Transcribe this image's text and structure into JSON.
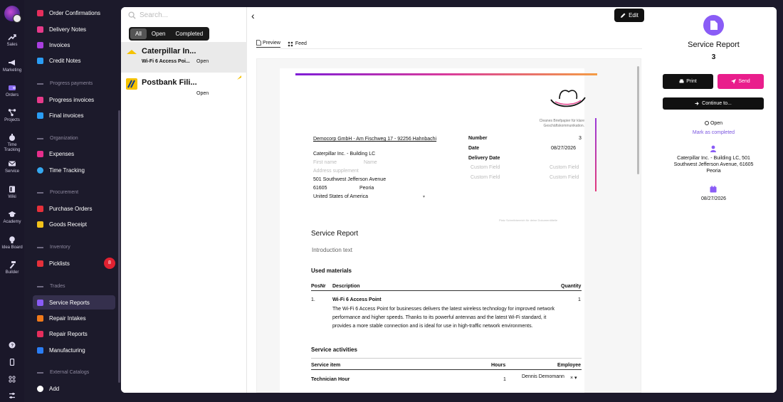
{
  "rail": {
    "items": [
      "Sales",
      "Marketing",
      "Orders",
      "Projects",
      "Time Tracking",
      "Service",
      "Wiki",
      "Academy",
      "Idea Board",
      "Builder"
    ]
  },
  "sidebar": {
    "items": [
      "Order Confirmations",
      "Delivery Notes",
      "Invoices",
      "Credit Notes",
      "Progress invoices",
      "Final invoices",
      "Expenses",
      "Time Tracking",
      "Purchase Orders",
      "Goods Receipt",
      "Picklists",
      "Service Reports",
      "Repair Intakes",
      "Repair Reports",
      "Manufacturing",
      "Add"
    ],
    "groups": [
      "Progress payments",
      "Organization",
      "Procurement",
      "Inventory",
      "Trades",
      "External Catalogs"
    ],
    "picklists_badge": "8"
  },
  "list": {
    "search_placeholder": "Search...",
    "filters": [
      "All",
      "Open",
      "Completed"
    ],
    "cards": [
      {
        "title": "Caterpillar In...",
        "sub": "Wi-Fi 6 Access Poi...",
        "status": "Open"
      },
      {
        "title": "Postbank Fili...",
        "sub": "",
        "status": "Open"
      }
    ]
  },
  "doc": {
    "edit": "Edit",
    "tab_preview": "Preview",
    "tab_feed": "Feed",
    "tagline": "Cleanes Briefpapier für klare Geschäftskommunikation.",
    "sender": "Democorp GmbH - Am Fischweg 17 - 92256 Hahnbachi",
    "recipient": "Caterpillar Inc. - Building LC",
    "first_name": "First name",
    "name": "Name",
    "address_supplement": "Address supplement",
    "street": "501 Southwest Jefferson Avenue",
    "zip": "61605",
    "city": "Peoria",
    "country": "United States of America",
    "number_label": "Number",
    "number": "3",
    "date_label": "Date",
    "date": "08/27/2026",
    "delivery_label": "Delivery Date",
    "custom_field": "Custom Field",
    "footer_note": "Platz Schreibbereich für deine Dokumenttitelle",
    "title": "Service Report",
    "intro": "Introduction text",
    "used_materials": "Used materials",
    "col_pos": "PosNr",
    "col_desc": "Description",
    "col_qty": "Quantity",
    "row_pos": "1.",
    "row_name": "Wi-Fi 6 Access Point",
    "row_qty": "1",
    "row_desc1": "The Wi-Fi 6 Access Point for businesses delivers the latest wireless technology for improved network",
    "row_desc2": "performance and higher speeds. Thanks to its powerful antennas and the latest Wi-Fi standard, it",
    "row_desc3": "provides a more stable connection and is ideal for use in high-traffic network environments.",
    "service_activities": "Service activities",
    "col_service": "Service item",
    "col_hours": "Hours",
    "col_employee": "Employee",
    "svc_name": "Technician Hour",
    "svc_hours": "1",
    "svc_employee": "Dennis Demomann"
  },
  "panel": {
    "title": "Service Report",
    "number": "3",
    "print": "Print",
    "send": "Send",
    "continue": "Continue to...",
    "status": "Open",
    "mark": "Mark as completed",
    "address1": "Caterpillar Inc. - Building LC, 501",
    "address2": "Southwest Jefferson Avenue, 61605",
    "address3": "Peoria",
    "date": "08/27/2026"
  },
  "colors": {
    "accent": "#8a5cf6",
    "send": "#e91e8c",
    "badge": "#e02131"
  }
}
